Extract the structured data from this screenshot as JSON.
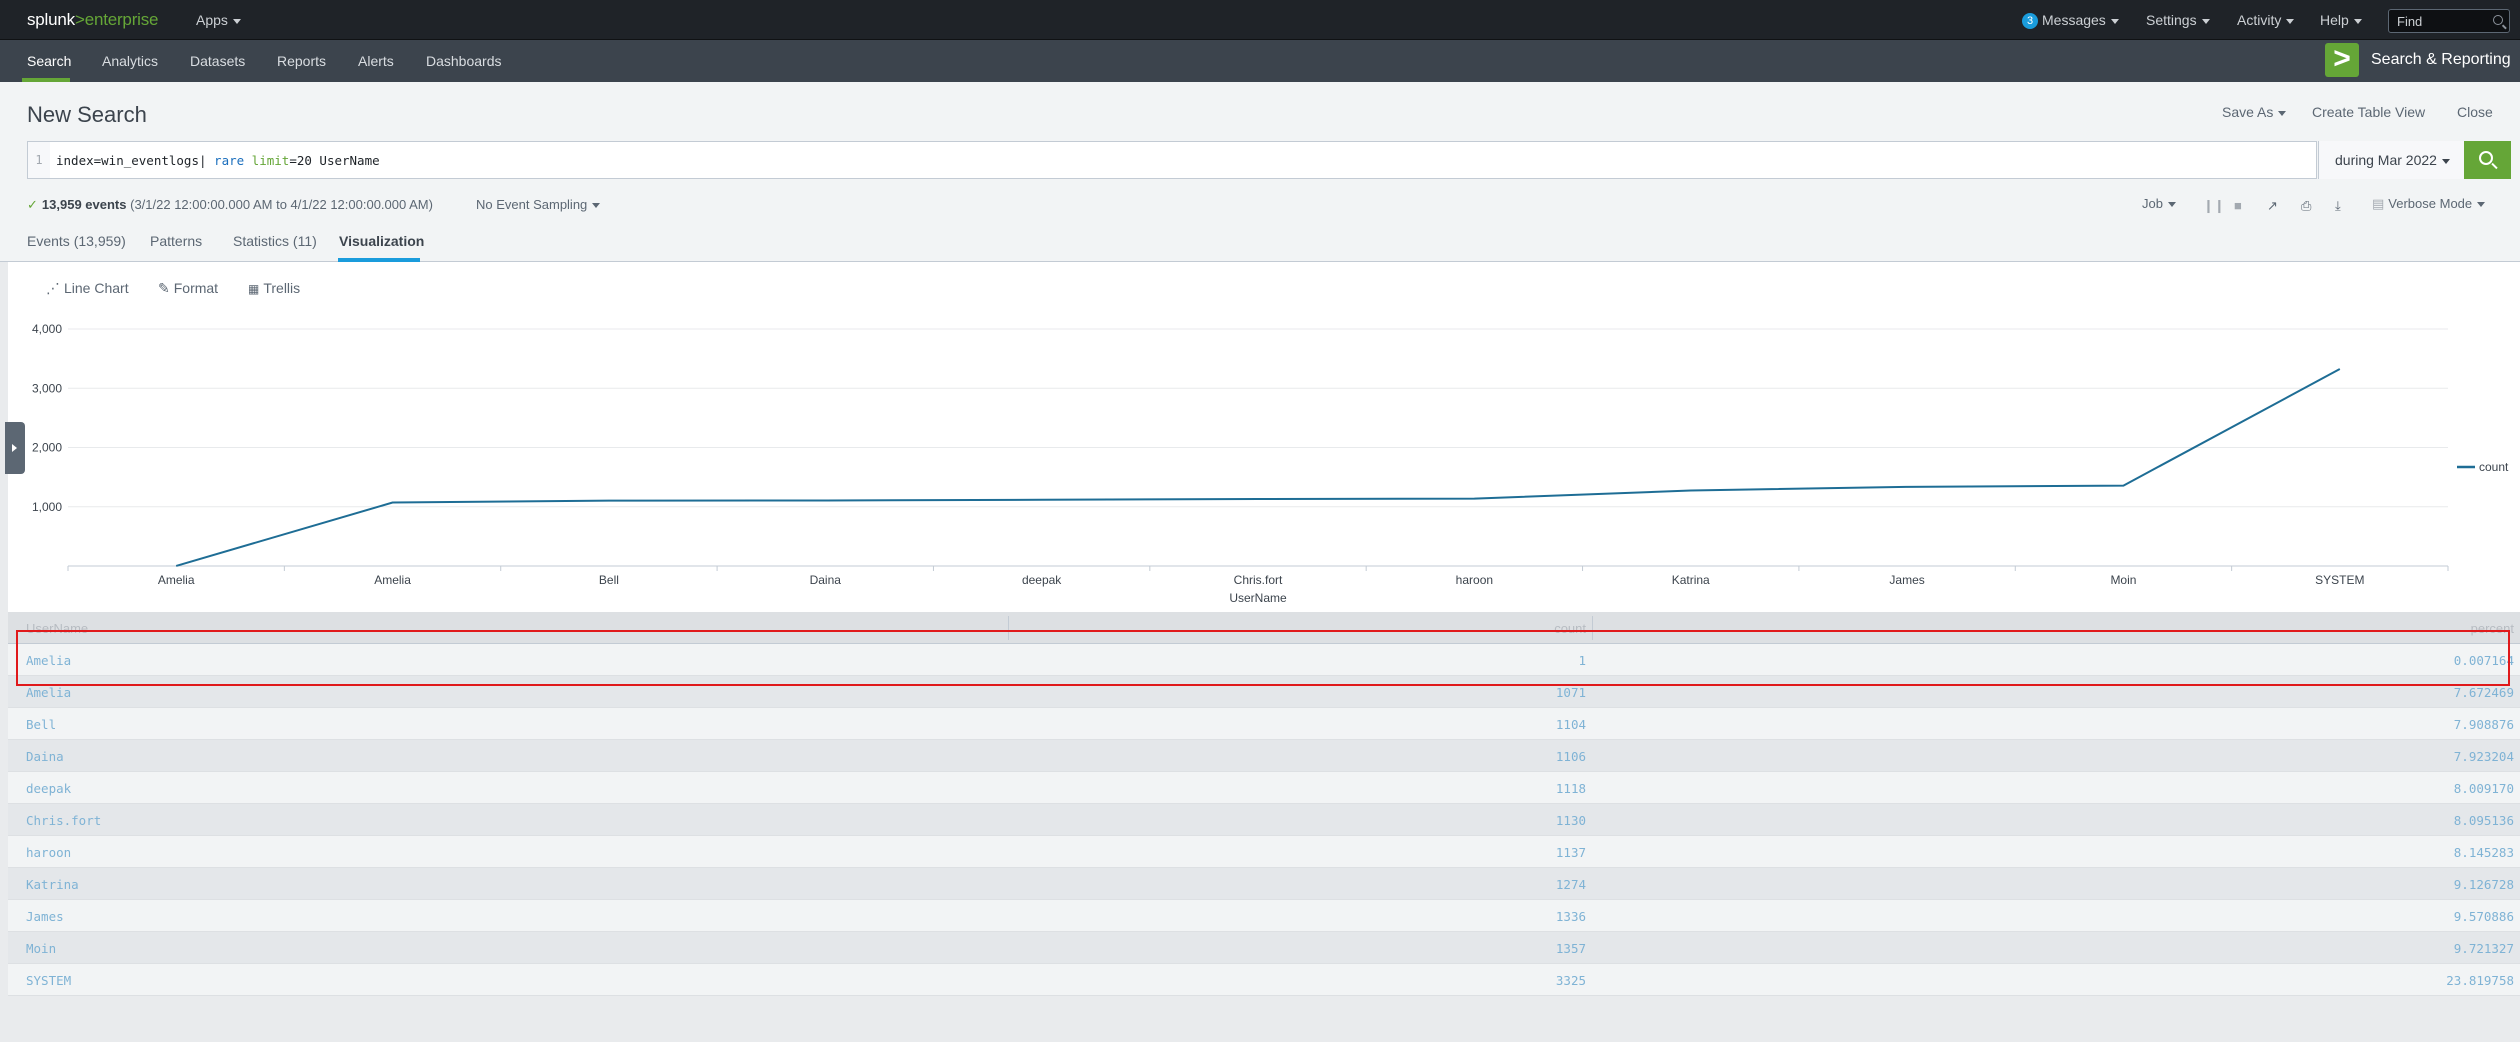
{
  "topbar": {
    "logo_brand": "splunk",
    "logo_sep": ">",
    "logo_product": "enterprise",
    "apps": "Apps",
    "messages_count": "3",
    "messages": "Messages",
    "settings": "Settings",
    "activity": "Activity",
    "help": "Help",
    "find_placeholder": "Find"
  },
  "appbar": {
    "tabs": [
      "Search",
      "Analytics",
      "Datasets",
      "Reports",
      "Alerts",
      "Dashboards"
    ],
    "app_logo": ">",
    "app_name": "Search & Reporting"
  },
  "header": {
    "title": "New Search",
    "save_as": "Save As",
    "create_table_view": "Create Table View",
    "close": "Close"
  },
  "search": {
    "line_number": "1",
    "query_base": "index=win_eventlogs| ",
    "query_cmd": "rare",
    "query_arg": " limit",
    "query_rest": "=20 UserName",
    "time_range": "during Mar 2022"
  },
  "status": {
    "events": "13,959 events",
    "range": "(3/1/22 12:00:00.000 AM to 4/1/22 12:00:00.000 AM)",
    "sampling": "No Event Sampling",
    "job": "Job",
    "mode": "Verbose Mode"
  },
  "result_tabs": [
    "Events (13,959)",
    "Patterns",
    "Statistics (11)",
    "Visualization"
  ],
  "viz_toolbar": {
    "chart_type": "Line Chart",
    "format": "Format",
    "trellis": "Trellis"
  },
  "chart_data": {
    "type": "line",
    "xlabel": "UserName",
    "ylabel": "count",
    "ylim": [
      0,
      4000
    ],
    "yticks": [
      "1,000",
      "2,000",
      "3,000",
      "4,000"
    ],
    "categories": [
      "Amelia",
      "Amelia",
      "Bell",
      "Daina",
      "deepak",
      "Chris.fort",
      "haroon",
      "Katrina",
      "James",
      "Moin",
      "SYSTEM"
    ],
    "series": [
      {
        "name": "count",
        "values": [
          1,
          1071,
          1104,
          1106,
          1118,
          1130,
          1137,
          1274,
          1336,
          1357,
          3325
        ]
      }
    ],
    "legend": "right",
    "grid": true,
    "colors": {
      "line": "#1e6d95"
    }
  },
  "table": {
    "headers": [
      "UserName",
      "count",
      "percent"
    ],
    "rows": [
      [
        "Amelia",
        "1",
        "0.007164"
      ],
      [
        "Amelia",
        "1071",
        "7.672469"
      ],
      [
        "Bell",
        "1104",
        "7.908876"
      ],
      [
        "Daina",
        "1106",
        "7.923204"
      ],
      [
        "deepak",
        "1118",
        "8.009170"
      ],
      [
        "Chris.fort",
        "1130",
        "8.095136"
      ],
      [
        "haroon",
        "1137",
        "8.145283"
      ],
      [
        "Katrina",
        "1274",
        "9.126728"
      ],
      [
        "James",
        "1336",
        "9.570886"
      ],
      [
        "Moin",
        "1357",
        "9.721327"
      ],
      [
        "SYSTEM",
        "3325",
        "23.819758"
      ]
    ]
  }
}
